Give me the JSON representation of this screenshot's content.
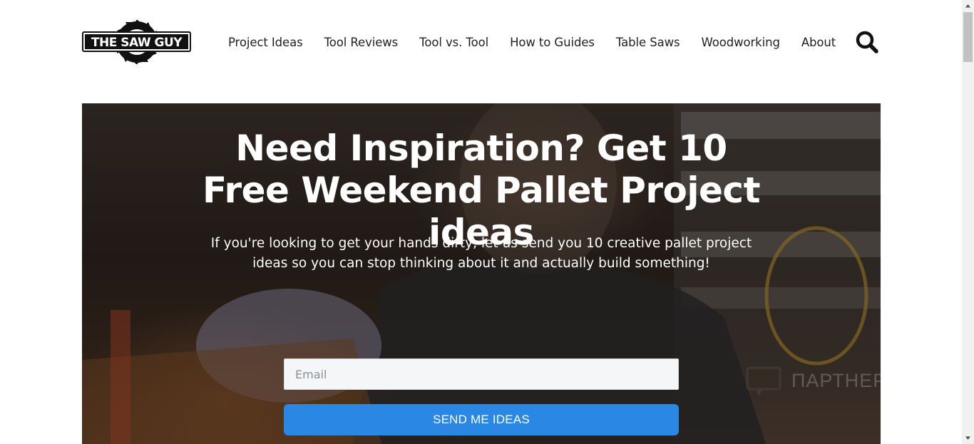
{
  "header": {
    "logo_text": "THE SAW GUY",
    "nav": [
      {
        "label": "Project Ideas"
      },
      {
        "label": "Tool Reviews"
      },
      {
        "label": "Tool vs. Tool"
      },
      {
        "label": "How to Guides"
      },
      {
        "label": "Table Saws"
      },
      {
        "label": "Woodworking"
      },
      {
        "label": "About"
      }
    ],
    "search_icon": "search-icon"
  },
  "hero": {
    "title": "Need Inspiration? Get 10 Free Weekend Pallet Project ideas",
    "subtitle": "If you're looking to get your hands dirty, let us send you 10 creative pallet project ideas so you can stop thinking about it and actually build something!",
    "email_placeholder": "Email",
    "email_value": "",
    "button_label": "SEND ME IDEAS"
  },
  "watermark": {
    "text": "ПАРТНЕРКИН"
  },
  "colors": {
    "button": "#2a87e3",
    "text": "#222222",
    "hero_text": "#ffffff"
  }
}
